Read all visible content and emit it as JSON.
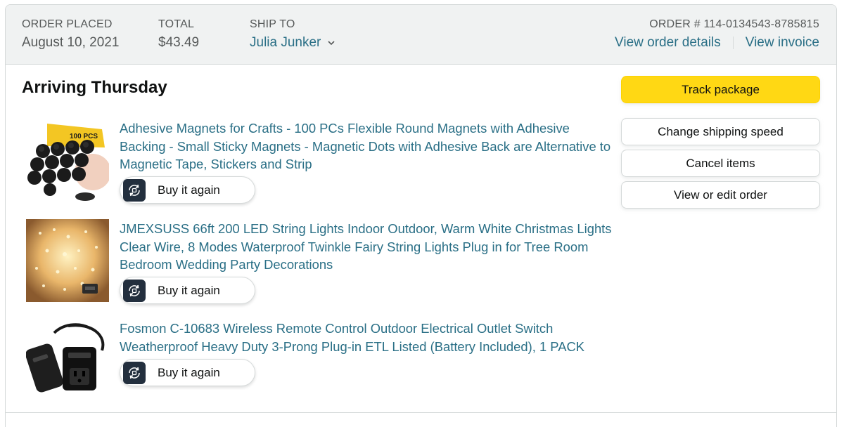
{
  "header": {
    "order_placed_label": "ORDER PLACED",
    "order_placed_value": "August 10, 2021",
    "total_label": "TOTAL",
    "total_value": "$43.49",
    "ship_to_label": "SHIP TO",
    "ship_to_value": "Julia Junker",
    "order_number": "ORDER # 114-0134543-8785815",
    "view_order_details": "View order details",
    "view_invoice": "View invoice"
  },
  "shipment": {
    "status": "Arriving Thursday"
  },
  "items": [
    {
      "title": "Adhesive Magnets for Crafts - 100 PCs Flexible Round Magnets with Adhesive Backing - Small Sticky Magnets - Magnetic Dots with Adhesive Back are Alternative to Magnetic Tape, Stickers and Strip",
      "buy_again": "Buy it again",
      "thumb_badge": "100 PCS"
    },
    {
      "title": "JMEXSUSS 66ft 200 LED String Lights Indoor Outdoor, Warm White Christmas Lights Clear Wire, 8 Modes Waterproof Twinkle Fairy String Lights Plug in for Tree Room Bedroom Wedding Party Decorations",
      "buy_again": "Buy it again"
    },
    {
      "title": "Fosmon C-10683 Wireless Remote Control Outdoor Electrical Outlet Switch Weatherproof Heavy Duty 3-Prong Plug-in ETL Listed (Battery Included), 1 PACK",
      "buy_again": "Buy it again"
    }
  ],
  "actions": {
    "track_package": "Track package",
    "change_shipping_speed": "Change shipping speed",
    "cancel_items": "Cancel items",
    "view_or_edit_order": "View or edit order"
  },
  "colors": {
    "link": "#2a6f86",
    "primary_button": "#ffd814",
    "header_bg": "#f0f2f2",
    "border": "#d5d9d9"
  }
}
